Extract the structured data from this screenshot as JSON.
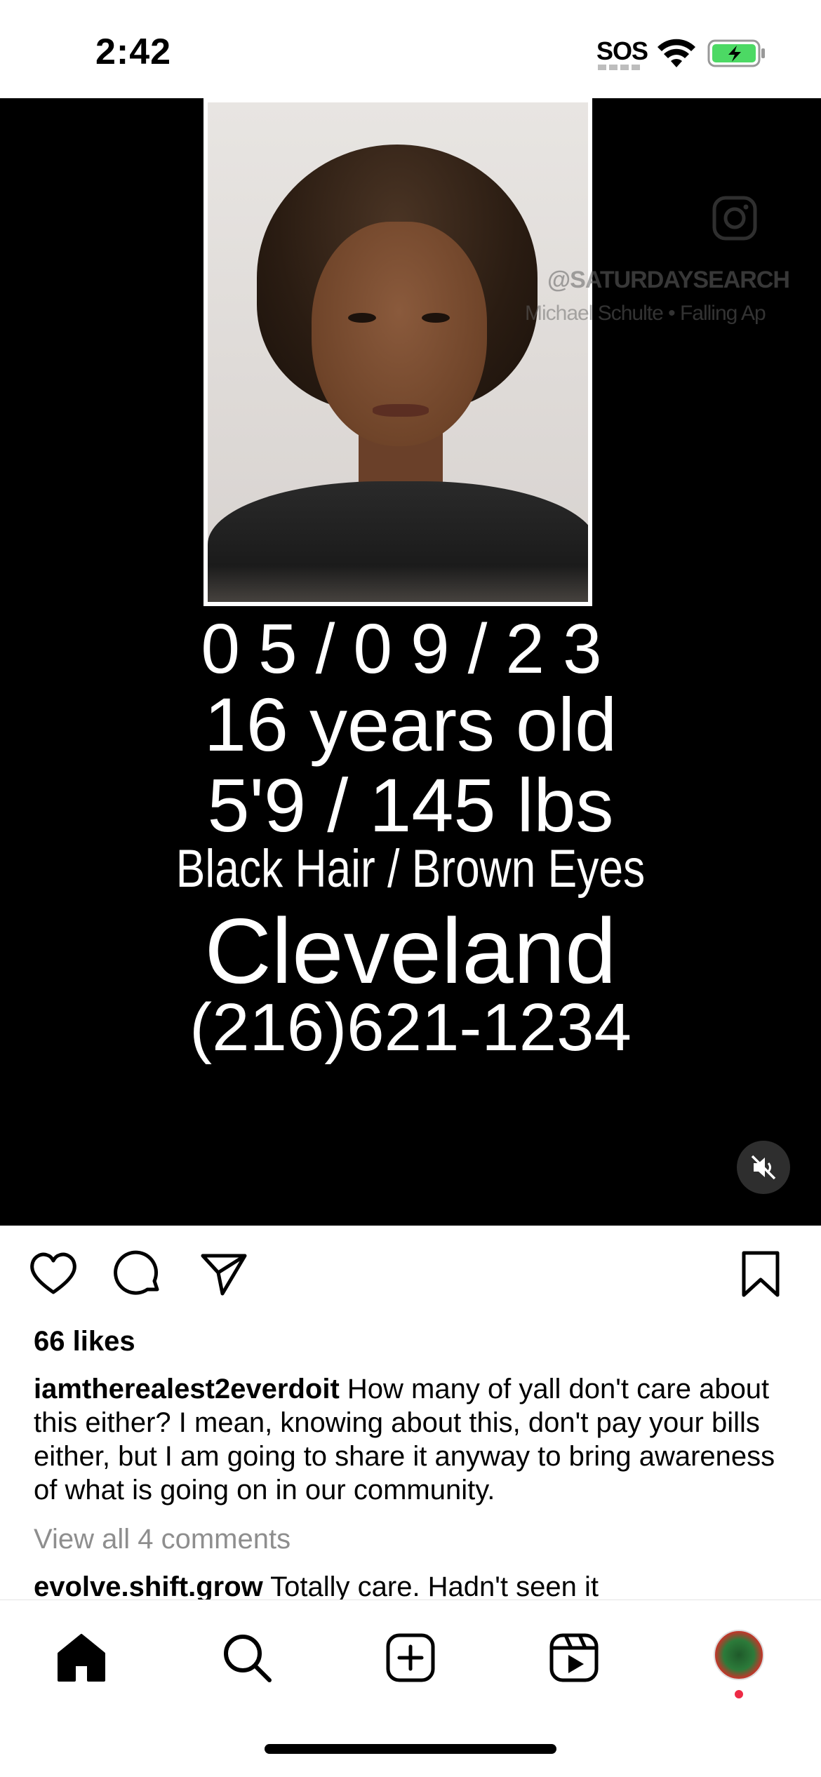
{
  "status_bar": {
    "time": "2:42",
    "sos": "SOS"
  },
  "post": {
    "media": {
      "watermark_handle": "@SATURDAYSEARCH",
      "watermark_sub": "Michael Schulte • Falling Ap",
      "lines": {
        "date": "05/09/23",
        "age": "16 years old",
        "height_weight": "5'9 / 145 lbs",
        "hair_eyes": "Black Hair / Brown Eyes",
        "city": "Cleveland",
        "phone": "(216)621-1234"
      }
    },
    "likes": "66 likes",
    "caption": {
      "username": "iamtherealest2everdoit",
      "text": " How many of yall don't care about this either? I mean, knowing about this, don't pay your bills either, but I am going to share it anyway to bring awareness of what is going on in our community."
    },
    "view_all_comments": "View all 4 comments",
    "preview_comment": {
      "username": "evolve.shift.grow",
      "text": " Totally care. Hadn't seen it"
    }
  },
  "icons": {
    "actions": [
      "heart-icon",
      "comment-icon",
      "share-icon",
      "bookmark-icon"
    ],
    "tabs": [
      "home-icon",
      "search-icon",
      "create-icon",
      "reels-icon",
      "profile-avatar"
    ]
  },
  "colors": {
    "media_bg": "#000000",
    "secondary_text": "#8e8e8e",
    "notification_dot": "#ed2a45",
    "battery_green": "#4cd964"
  }
}
